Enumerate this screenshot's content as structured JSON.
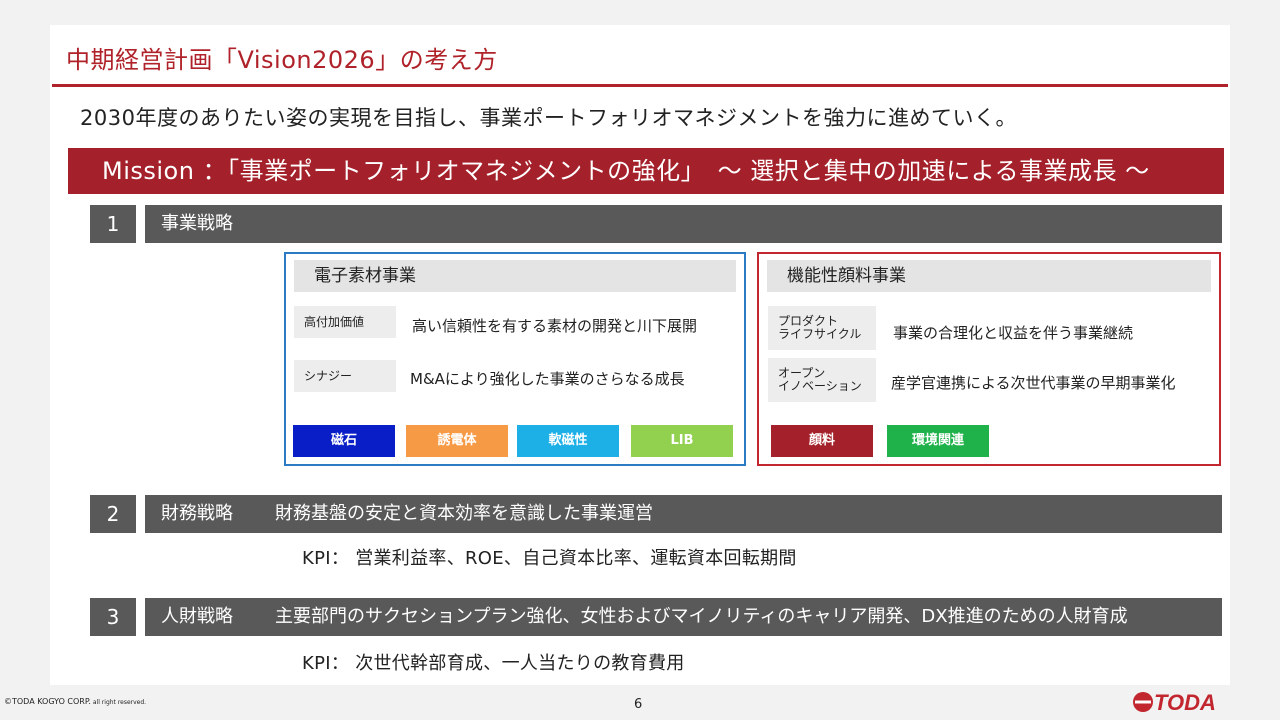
{
  "slide": {
    "title": "中期経営計画「Vision2026」の考え方",
    "lead": "2030年度のありたい姿の実現を目指し、事業ポートフォリオマネジメントを強力に進めていく。",
    "mission": "Mission ：「事業ポートフォリオマネジメントの強化」　～ 選択と集中の加速による事業成長 ～"
  },
  "sections": [
    {
      "num": "1",
      "name": "事業戦略",
      "desc": ""
    },
    {
      "num": "2",
      "name": "財務戦略",
      "desc": "財務基盤の安定と資本効率を意識した事業運営",
      "kpi": "KPI：  営業利益率、ROE、自己資本比率、運転資本回転期間"
    },
    {
      "num": "3",
      "name": "人財戦略",
      "desc": "主要部門のサクセションプラン強化、女性およびマイノリティのキャリア開発、DX推進のための人財育成",
      "kpi": "KPI：  次世代幹部育成、一人当たりの教育費用"
    }
  ],
  "electronic": {
    "title": "電子素材事業",
    "rows": [
      {
        "label": "高付加価値",
        "text": "高い信頼性を有する素材の開発と川下展開"
      },
      {
        "label": "シナジー",
        "text": "M&Aにより強化した事業のさらなる成長"
      }
    ],
    "tags": [
      {
        "label": "磁石",
        "color": "#0a1ec8"
      },
      {
        "label": "誘電体",
        "color": "#f79a45"
      },
      {
        "label": "軟磁性",
        "color": "#1cb0e6"
      },
      {
        "label": "LIB",
        "color": "#92d050"
      }
    ]
  },
  "pigment": {
    "title": "機能性顔料事業",
    "rows": [
      {
        "label": "プロダクト\nライフサイクル",
        "text": "事業の合理化と収益を伴う事業継続"
      },
      {
        "label": "オープン\nイノベーション",
        "text": "産学官連携による次世代事業の早期事業化"
      }
    ],
    "tags": [
      {
        "label": "顔料",
        "color": "#a4202a"
      },
      {
        "label": "環境関連",
        "color": "#1fb24a"
      }
    ]
  },
  "footer": {
    "copyright": "©TODA KOGYO CORP.",
    "rights": " all right reserved.",
    "page": "6",
    "logo_text": "TODA",
    "brand_color": "#c2262e"
  }
}
